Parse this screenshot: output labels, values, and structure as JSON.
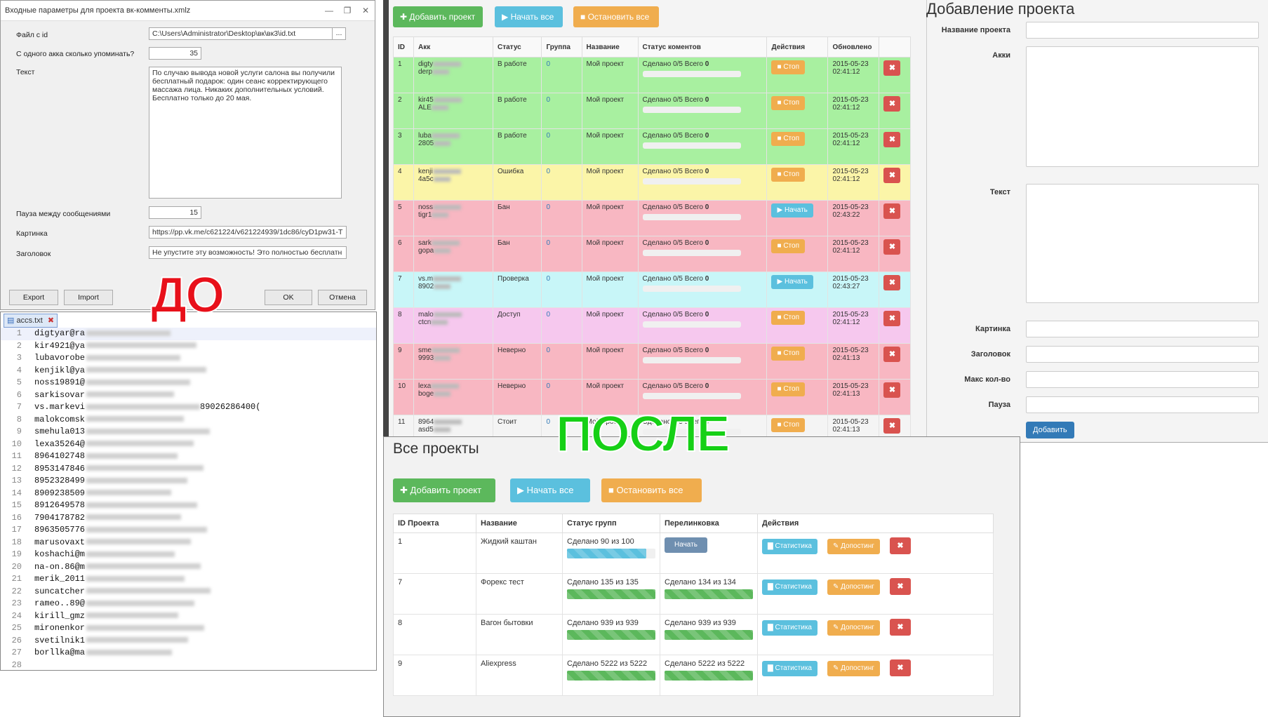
{
  "dialog": {
    "title": "Входные параметры для проекта вк-комменты.xmlz",
    "fields": [
      {
        "label": "Файл с id",
        "value": "C:\\Users\\Administrator\\Desktop\\вк\\вк3\\id.txt"
      },
      {
        "label": "С одного акка сколько упоминать?",
        "value": "35"
      },
      {
        "label": "Текст",
        "value": "По случаю вывода новой услуги салона вы получили бесплатный подарок: один сеанс корректирующего массажа лица. Никаких дополнительных условий. Бесплатно только до 20 мая."
      },
      {
        "label": "Пауза между сообщениями",
        "value": "15"
      },
      {
        "label": "Картинка",
        "value": "https://pp.vk.me/c621224/v621224939/1dc86/cyD1pw31-T"
      },
      {
        "label": "Заголовок",
        "value": "Не упустите эту возможность! Это полностью бесплатн"
      }
    ],
    "browse": "...",
    "buttons": {
      "export": "Export",
      "import": "Import",
      "ok": "OK",
      "cancel": "Отмена"
    }
  },
  "notepad": {
    "tab": "accs.txt",
    "lines": [
      {
        "n": "1",
        "t": "digtyar@ra"
      },
      {
        "n": "2",
        "t": "kir4921@ya"
      },
      {
        "n": "3",
        "t": "lubavorobe"
      },
      {
        "n": "4",
        "t": "kenjikl@ya"
      },
      {
        "n": "5",
        "t": "noss19891@"
      },
      {
        "n": "6",
        "t": "sarkisovar"
      },
      {
        "n": "7",
        "t": "vs.markevi"
      },
      {
        "n": "8",
        "t": "malokcomsk"
      },
      {
        "n": "9",
        "t": "smehula013"
      },
      {
        "n": "10",
        "t": "lexa35264@"
      },
      {
        "n": "11",
        "t": "8964102748"
      },
      {
        "n": "12",
        "t": "8953147846"
      },
      {
        "n": "13",
        "t": "8952328499"
      },
      {
        "n": "14",
        "t": "8909238509"
      },
      {
        "n": "15",
        "t": "8912649578"
      },
      {
        "n": "16",
        "t": "7904178782"
      },
      {
        "n": "17",
        "t": "8963505776"
      },
      {
        "n": "18",
        "t": "marusovaxt"
      },
      {
        "n": "19",
        "t": "koshachi@m"
      },
      {
        "n": "20",
        "t": "na-on.86@m"
      },
      {
        "n": "21",
        "t": "merik_2011"
      },
      {
        "n": "22",
        "t": "suncatcher"
      },
      {
        "n": "23",
        "t": "rameo..89@"
      },
      {
        "n": "24",
        "t": "kirill_gmz"
      },
      {
        "n": "25",
        "t": "mironenkor"
      },
      {
        "n": "26",
        "t": "svetilnik1"
      },
      {
        "n": "27",
        "t": "borllka@ma"
      },
      {
        "n": "28",
        "t": ""
      }
    ],
    "line7_tail": "89026286400("
  },
  "labels": {
    "before": "ДО",
    "after": "ПОСЛЕ"
  },
  "top": {
    "add": "Добавить проект",
    "start_all": "Начать все",
    "stop_all": "Остановить все",
    "headers": [
      "ID",
      "Акк",
      "Статус",
      "Группа",
      "Название",
      "Статус коментов",
      "Действия",
      "Обновлено"
    ],
    "rows": [
      {
        "id": "1",
        "acc1": "digty",
        "acc2": "derp",
        "status": "В работе",
        "group": "0",
        "name": "Мой проект",
        "cstatus": "Сделано 0/5 Всего",
        "total": "0",
        "action": "Стоп",
        "updated": "2015-05-23 02:41:12",
        "color": "#a8f0a0"
      },
      {
        "id": "2",
        "acc1": "kir45",
        "acc2": "ALE",
        "status": "В работе",
        "group": "0",
        "name": "Мой проект",
        "cstatus": "Сделано 0/5 Всего",
        "total": "0",
        "action": "Стоп",
        "updated": "2015-05-23 02:41:12",
        "color": "#a8f0a0"
      },
      {
        "id": "3",
        "acc1": "luba",
        "acc2": "2805",
        "status": "В работе",
        "group": "0",
        "name": "Мой проект",
        "cstatus": "Сделано 0/5 Всего",
        "total": "0",
        "action": "Стоп",
        "updated": "2015-05-23 02:41:12",
        "color": "#a8f0a0"
      },
      {
        "id": "4",
        "acc1": "kenji",
        "acc2": "4a5c",
        "status": "Ошибка",
        "group": "0",
        "name": "Мой проект",
        "cstatus": "Сделано 0/5 Всего",
        "total": "0",
        "action": "Стоп",
        "updated": "2015-05-23 02:41:12",
        "color": "#fbf5a8"
      },
      {
        "id": "5",
        "acc1": "noss",
        "acc2": "tigr1",
        "status": "Бан",
        "group": "0",
        "name": "Мой проект",
        "cstatus": "Сделано 0/5 Всего",
        "total": "0",
        "action": "Начать",
        "updated": "2015-05-23 02:43:22",
        "color": "#f8b7c2"
      },
      {
        "id": "6",
        "acc1": "sark",
        "acc2": "gopa",
        "status": "Бан",
        "group": "0",
        "name": "Мой проект",
        "cstatus": "Сделано 0/5 Всего",
        "total": "0",
        "action": "Стоп",
        "updated": "2015-05-23 02:41:12",
        "color": "#f8b7c2"
      },
      {
        "id": "7",
        "acc1": "vs.m",
        "acc2": "8902",
        "status": "Проверка",
        "group": "0",
        "name": "Мой проект",
        "cstatus": "Сделано 0/5 Всего",
        "total": "0",
        "action": "Начать",
        "updated": "2015-05-23 02:43:27",
        "color": "#c8f6f8"
      },
      {
        "id": "8",
        "acc1": "malo",
        "acc2": "ctcn",
        "status": "Доступ",
        "group": "0",
        "name": "Мой проект",
        "cstatus": "Сделано 0/5 Всего",
        "total": "0",
        "action": "Стоп",
        "updated": "2015-05-23 02:41:12",
        "color": "#f6c8ee"
      },
      {
        "id": "9",
        "acc1": "sme",
        "acc2": "9993",
        "status": "Неверно",
        "group": "0",
        "name": "Мой проект",
        "cstatus": "Сделано 0/5 Всего",
        "total": "0",
        "action": "Стоп",
        "updated": "2015-05-23 02:41:13",
        "color": "#f8b7c2"
      },
      {
        "id": "10",
        "acc1": "lexa",
        "acc2": "boge",
        "status": "Неверно",
        "group": "0",
        "name": "Мой проект",
        "cstatus": "Сделано 0/5 Всего",
        "total": "0",
        "action": "Стоп",
        "updated": "2015-05-23 02:41:13",
        "color": "#f8b7c2"
      },
      {
        "id": "11",
        "acc1": "8964",
        "acc2": "asd5",
        "status": "Стоит",
        "group": "0",
        "name": "Мой проект",
        "cstatus": "Сделано 0/5 Всего",
        "total": "0",
        "action": "Стоп",
        "updated": "2015-05-23 02:41:13",
        "color": "#f4f4f4"
      }
    ]
  },
  "add_form": {
    "title": "Добавление проекта",
    "labels": {
      "name": "Название проекта",
      "accs": "Акки",
      "text": "Текст",
      "pic": "Картинка",
      "header": "Заголовок",
      "max": "Макс кол-во",
      "pause": "Пауза"
    },
    "submit": "Добавить"
  },
  "all": {
    "title": "Все проекты",
    "add": "Добавить проект",
    "start_all": "Начать все",
    "stop_all": "Остановить все",
    "headers": [
      "ID Проекта",
      "Название",
      "Статус групп",
      "Перелинковка",
      "Действия"
    ],
    "stat": "Статистика",
    "repost": "Допостинг",
    "rows": [
      {
        "id": "1",
        "name": "Жидкий каштан",
        "groups": "Сделано 90 из 100",
        "groups_frac": 0.9,
        "link": "Начать",
        "link_is_button": true
      },
      {
        "id": "7",
        "name": "Форекс тест",
        "groups": "Сделано 135 из 135",
        "groups_frac": 1,
        "link": "Сделано 134 из 134",
        "link_is_button": false
      },
      {
        "id": "8",
        "name": "Вагон бытовки",
        "groups": "Сделано 939 из 939",
        "groups_frac": 1,
        "link": "Сделано 939 из 939",
        "link_is_button": false
      },
      {
        "id": "9",
        "name": "Aliexpress",
        "groups": "Сделано 5222 из 5222",
        "groups_frac": 1,
        "link": "Сделано 5222 из 5222",
        "link_is_button": false
      }
    ]
  },
  "colors": {
    "green": "#5cb85c",
    "blue": "#5bc0de",
    "orange": "#f0ad4e",
    "red": "#d9534f",
    "navy": "#337ab7"
  }
}
